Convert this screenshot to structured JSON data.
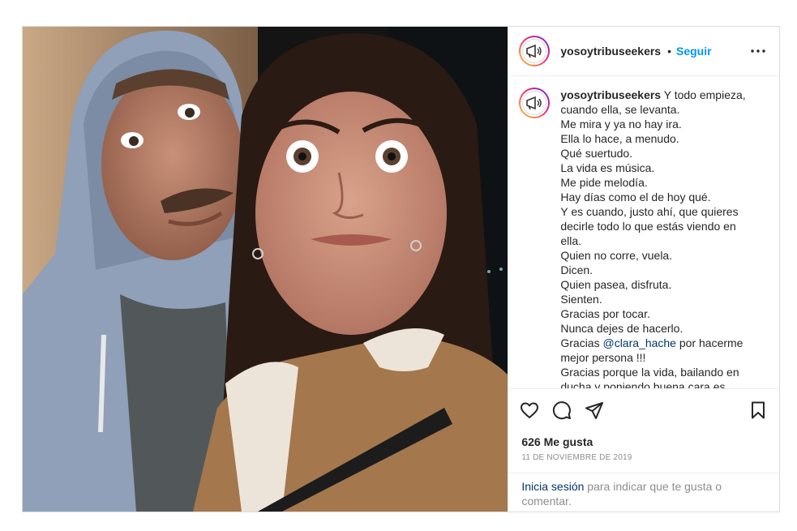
{
  "post": {
    "username": "yosoytribuseekers",
    "separator": "•",
    "follow_label": "Seguir",
    "caption": {
      "username": "yosoytribuseekers",
      "lines": [
        "Y todo empieza,",
        "cuando ella, se levanta.",
        "Me mira y ya no hay ira.",
        "Ella lo hace, a menudo.",
        "Qué suertudo.",
        "La vida es música.",
        "Me pide melodía.",
        "Hay días como el de hoy qué.",
        "Y es cuando, justo ahí, que quieres",
        "decirle todo lo que estás viendo en",
        "ella.",
        "Quien no corre, vuela.",
        "Dicen.",
        "Quien pasea, disfruta.",
        "Sienten.",
        "Gracias por tocar.",
        "Nunca dejes de hacerlo."
      ],
      "thanks_prefix": "Gracias ",
      "mention": "@clara_hache",
      "thanks_suffix": " por hacerme",
      "lines_after": [
        "mejor persona !!!",
        "Gracias porque la vida, bailando en",
        "ducha y poniendo buena cara es"
      ]
    },
    "likes": "626 Me gusta",
    "date": "11 DE NOVIEMBRE DE 2019",
    "login_link": "Inicia sesión",
    "login_text": " para indicar que te gusta o comentar."
  },
  "icons": {
    "more": "more-options-icon",
    "like": "heart-icon",
    "comment": "comment-icon",
    "share": "share-icon",
    "save": "bookmark-icon"
  }
}
